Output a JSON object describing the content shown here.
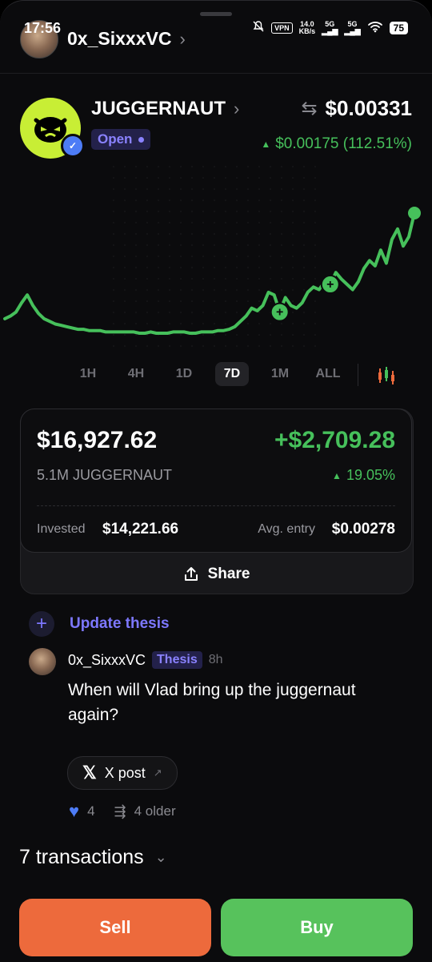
{
  "status_bar": {
    "time": "17:56",
    "vpn": "VPN",
    "speed_top": "14.0",
    "speed_unit": "KB/s",
    "net1": "5G",
    "net2": "5G",
    "battery": "75"
  },
  "header": {
    "username": "0x_SixxxVC",
    "chevron": "›"
  },
  "token": {
    "name": "JUGGERNAUT",
    "status": "Open",
    "price": "$0.00331",
    "change": "$0.00175 (112.51%)",
    "icons": {
      "swap": "swap-arrows-icon",
      "verified": "verified-check-icon",
      "logo": "token-face-logo"
    }
  },
  "chart_data": {
    "type": "line",
    "series": [
      {
        "values": [
          20,
          22,
          25,
          32,
          38,
          30,
          24,
          20,
          18,
          16,
          15,
          14,
          13,
          12,
          12,
          11,
          11,
          11,
          10,
          10,
          10,
          10,
          10,
          10,
          9,
          9,
          10,
          9,
          9,
          9,
          10,
          10,
          10,
          9,
          9,
          10,
          10,
          10,
          11,
          11,
          12,
          14,
          18,
          22,
          28,
          26,
          30,
          40,
          38,
          25,
          36,
          30,
          28,
          32,
          40,
          44,
          42,
          48,
          46,
          55,
          50,
          46,
          42,
          48,
          58,
          64,
          60,
          72,
          62,
          80,
          88,
          75,
          82,
          100
        ]
      }
    ],
    "markers": [
      "+",
      "+"
    ],
    "range_options": [
      "1H",
      "4H",
      "1D",
      "7D",
      "1M",
      "ALL"
    ],
    "selected_range": "7D",
    "colors": {
      "line": "#46c05b",
      "background": "#0b0b0d"
    }
  },
  "position": {
    "value": "$16,927.62",
    "pnl": "+$2,709.28",
    "holding": "5.1M JUGGERNAUT",
    "pnl_pct": "19.05%",
    "invested_label": "Invested",
    "invested": "$14,221.66",
    "avg_label": "Avg. entry",
    "avg_entry": "$0.00278",
    "share_label": "Share"
  },
  "thesis": {
    "update_label": "Update thesis",
    "author": "0x_SixxxVC",
    "badge": "Thesis",
    "time": "8h",
    "text": "When will Vlad bring up the juggernaut again?",
    "xpost_label": "X post",
    "likes": "4",
    "older": "4 older"
  },
  "transactions": {
    "label": "7 transactions"
  },
  "actions": {
    "sell": "Sell",
    "buy": "Buy"
  }
}
